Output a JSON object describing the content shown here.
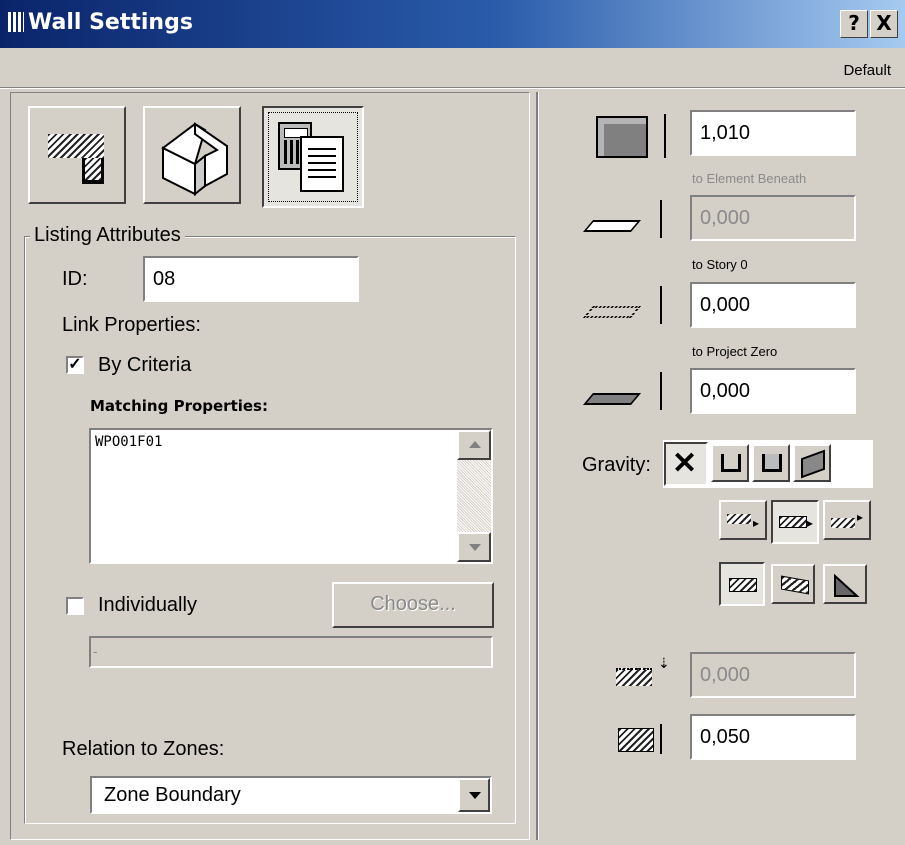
{
  "window": {
    "title": "Wall Settings",
    "help_label": "?",
    "close_label": "X",
    "preset": "Default"
  },
  "tabs": {
    "floor_plan": "floor-plan-tab",
    "model": "3d-model-tab",
    "listing": "listing-tab"
  },
  "listing": {
    "group_title": "Listing Attributes",
    "id_label": "ID:",
    "id_value": "08",
    "link_properties_label": "Link Properties:",
    "by_criteria_label": "By Criteria",
    "by_criteria_checked": true,
    "by_criteria_mark": "✓",
    "matching_label": "Matching Properties:",
    "matching_items": [
      "WPO01F01"
    ],
    "individually_label": "Individually",
    "individually_checked": false,
    "choose_label": "Choose...",
    "individual_value": "-",
    "relation_label": "Relation to Zones:",
    "relation_value": "Zone Boundary"
  },
  "geometry": {
    "height_value": "1,010",
    "to_element_beneath_label": "to Element Beneath",
    "element_beneath_value": "0,000",
    "to_story_label": "to Story 0",
    "story_value": "0,000",
    "to_project_zero_label": "to Project Zero",
    "project_zero_value": "0,000",
    "gravity_label": "Gravity:",
    "offset_value": "0,000",
    "thickness_value": "0,050"
  }
}
